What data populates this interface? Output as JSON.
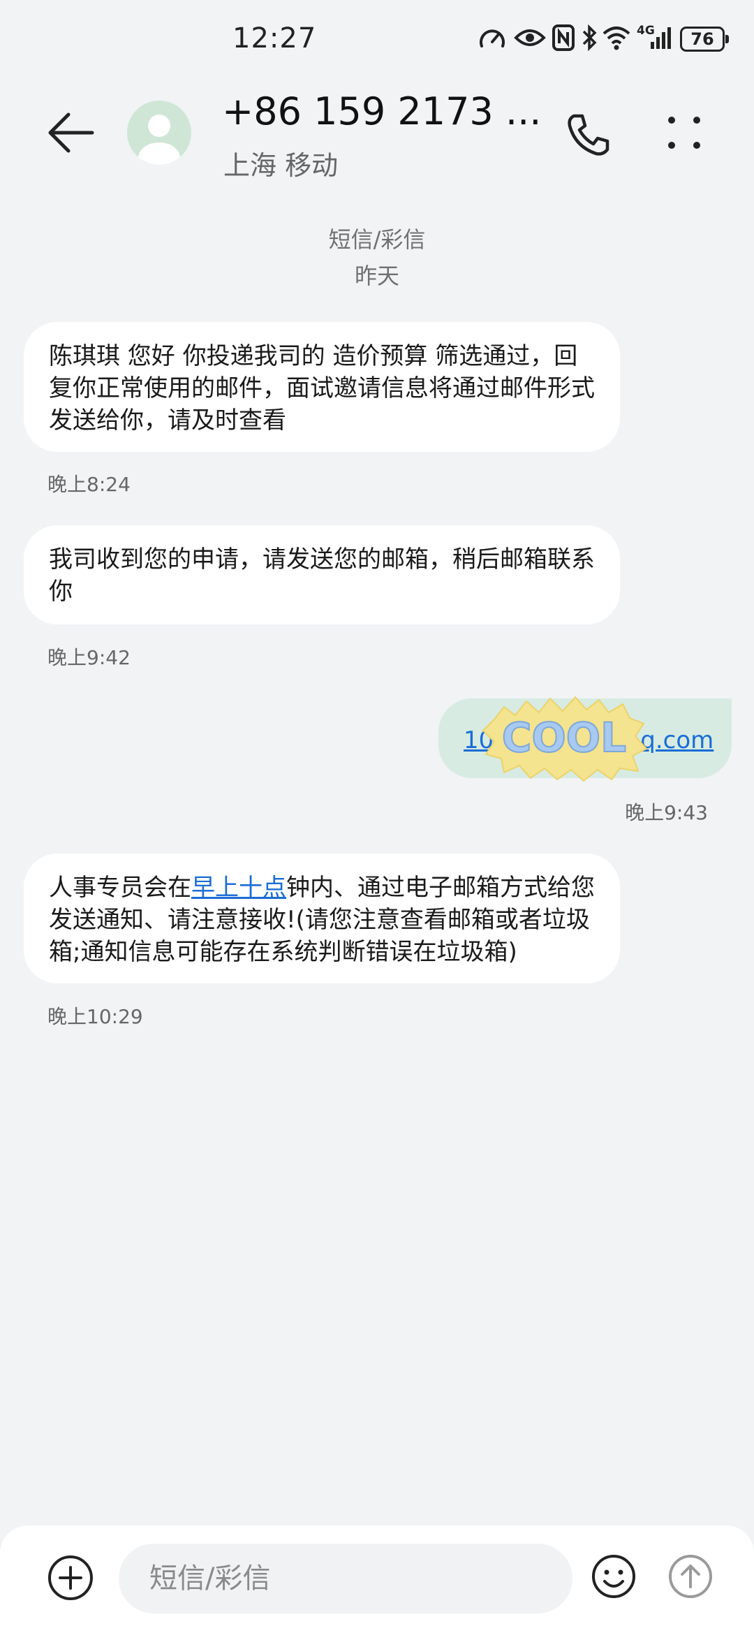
{
  "status_bar": {
    "time": "12:27",
    "network": "4G",
    "battery": "76",
    "icons": [
      "speed-icon",
      "eye-icon",
      "nfc-icon",
      "bluetooth-icon",
      "wifi-icon",
      "signal-icon",
      "battery-icon"
    ]
  },
  "header": {
    "contact_name": "+86 159 2173 ...",
    "carrier": "上海 移动",
    "icons": [
      "back-arrow-icon",
      "avatar-icon",
      "phone-icon",
      "more-icon"
    ]
  },
  "thread": {
    "message_type": "短信/彩信",
    "day": "昨天"
  },
  "messages": [
    {
      "text": "陈琪琪  您好 你投递我司的 造价预算  筛选通过，回复你正常使用的邮件，面试邀请信息将通过邮件形式发送给你，请及时查看",
      "time": "晚上8:24"
    },
    {
      "text": "我司收到您的申请，请发送您的邮箱，稍后邮箱联系你",
      "time": "晚上9:42"
    },
    {
      "link_start": "10",
      "link_end": "q.com",
      "time": "晚上9:43"
    },
    {
      "text_before": "人事专员会在",
      "link": "早上十点",
      "text_after": "钟内、通过电子邮箱方式给您发送通知、请注意接收!(请您注意查看邮箱或者垃圾箱;通知信息可能存在系统判断错误在垃圾箱)",
      "time": "晚上10:29"
    }
  ],
  "sticker": {
    "text": "COOL"
  },
  "composer": {
    "placeholder": "短信/彩信",
    "icons": [
      "add-icon",
      "emoji-icon",
      "send-icon"
    ]
  },
  "colors": {
    "link": "#1a6dd6",
    "outgoing_bubble": "#d7ebe2",
    "background": "#f1f3f5"
  }
}
